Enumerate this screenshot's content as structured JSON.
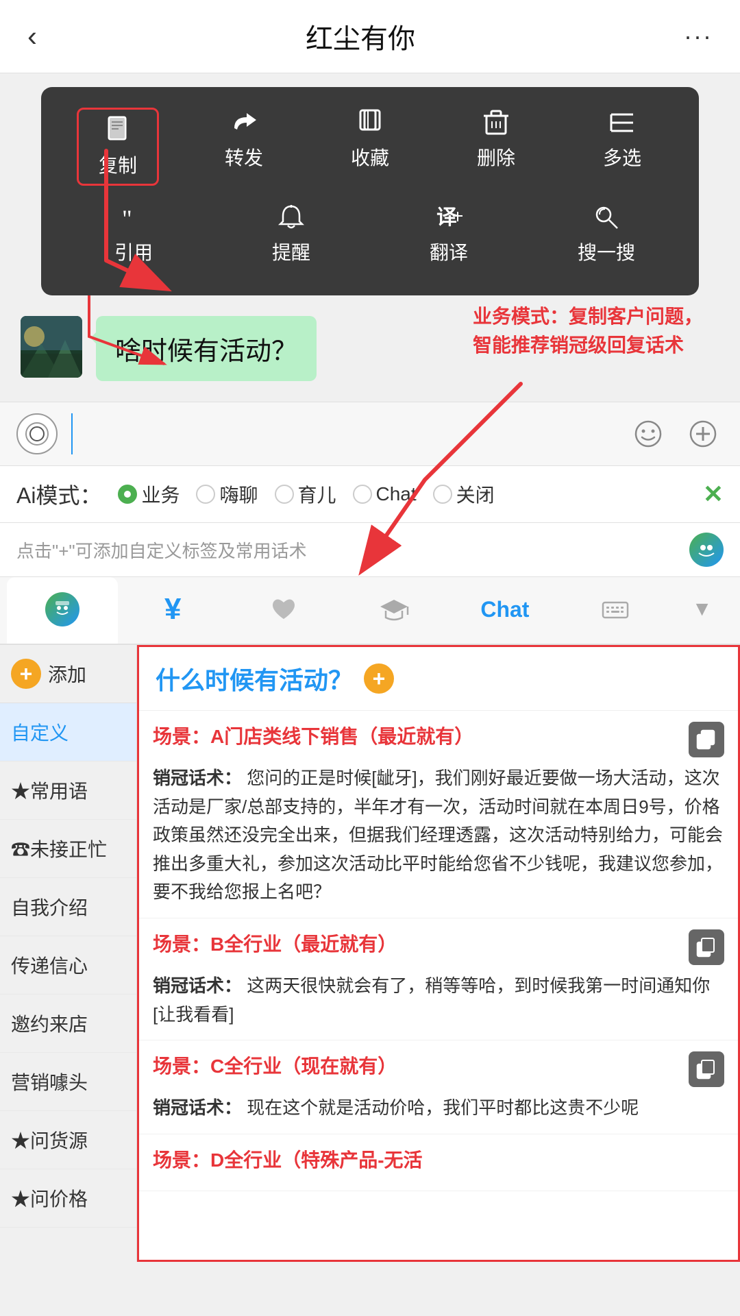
{
  "header": {
    "back_label": "‹",
    "title": "红尘有你",
    "more_label": "···"
  },
  "context_menu": {
    "row1": [
      {
        "icon": "📄",
        "label": "复制",
        "highlighted": true
      },
      {
        "icon": "↪",
        "label": "转发",
        "highlighted": false
      },
      {
        "icon": "◈",
        "label": "收藏",
        "highlighted": false
      },
      {
        "icon": "🗑",
        "label": "删除",
        "highlighted": false
      },
      {
        "icon": "☰",
        "label": "多选",
        "highlighted": false
      }
    ],
    "row2": [
      {
        "icon": "❝",
        "label": "引用",
        "highlighted": false
      },
      {
        "icon": "🔔",
        "label": "提醒",
        "highlighted": false
      },
      {
        "icon": "译",
        "label": "翻译",
        "highlighted": false
      },
      {
        "icon": "✳",
        "label": "搜一搜",
        "highlighted": false
      }
    ]
  },
  "chat": {
    "message": "啥时候有活动？"
  },
  "annotation": {
    "text": "业务模式：复制客户问题，\n智能推荐销冠级回复话术"
  },
  "input_bar": {
    "placeholder": ""
  },
  "ai_modes": {
    "label": "Ai模式：",
    "options": [
      {
        "label": "业务",
        "active": true
      },
      {
        "label": "嗨聊",
        "active": false
      },
      {
        "label": "育儿",
        "active": false
      },
      {
        "label": "Chat",
        "active": false
      },
      {
        "label": "关闭",
        "active": false
      }
    ],
    "close_label": "✕"
  },
  "hint": {
    "text": "点击\"+\"可添加自定义标签及常用话术"
  },
  "toolbar": {
    "items": [
      {
        "icon": "robot",
        "label": "chat",
        "type": "chat"
      },
      {
        "icon": "¥",
        "label": "money"
      },
      {
        "icon": "♥",
        "label": "heart"
      },
      {
        "icon": "🎓",
        "label": "graduation"
      },
      {
        "icon": "Chat",
        "label": "chat-text"
      },
      {
        "icon": "⌨",
        "label": "keyboard"
      }
    ],
    "down": "▼"
  },
  "sidebar": {
    "add_label": "添加",
    "items": [
      {
        "label": "自定义",
        "active": true
      },
      {
        "label": "★常用语",
        "active": false
      },
      {
        "label": "☎未接正忙",
        "active": false
      },
      {
        "label": "自我介绍",
        "active": false
      },
      {
        "label": "传递信心",
        "active": false
      },
      {
        "label": "邀约来店",
        "active": false
      },
      {
        "label": "营销噱头",
        "active": false
      },
      {
        "label": "★问货源",
        "active": false
      },
      {
        "label": "★问价格",
        "active": false
      }
    ]
  },
  "content": {
    "title": "什么时候有活动？",
    "blocks": [
      {
        "scene": "场景：A门店类线下销售（最近就有）",
        "script_label": "销冠话术：",
        "script": "您问的正是时候[龇牙]，我们刚好最近要做一场大活动，这次活动是厂家/总部支持的，半年才有一次，活动时间就在本周日9号，价格政策虽然还没完全出来，但据我们经理透露，这次活动特别给力，可能会推出多重大礼，参加这次活动比平时能给您省不少钱呢，我建议您参加，要不我给您报上名吧？"
      },
      {
        "scene": "场景：B全行业（最近就有）",
        "script_label": "销冠话术：",
        "script": "这两天很快就会有了，稍等等哈，到时候我第一时间通知你[让我看看]"
      },
      {
        "scene": "场景：C全行业（现在就有）",
        "script_label": "销冠话术：",
        "script": "现在这个就是活动价哈，我们平时都比这贵不少呢"
      },
      {
        "scene": "场景：D全行业（特殊产品-无活",
        "script_label": "",
        "script": ""
      }
    ]
  }
}
